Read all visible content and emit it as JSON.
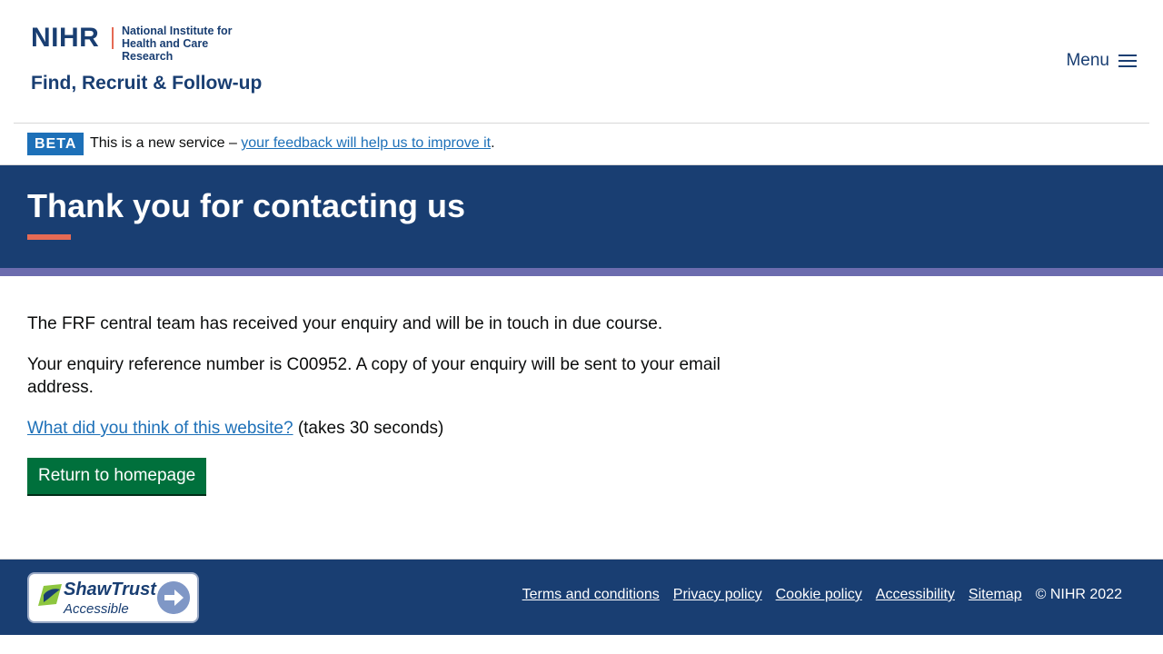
{
  "header": {
    "logo_org": "NIHR",
    "logo_inst_line1": "National Institute for",
    "logo_inst_line2": "Health and Care Research",
    "service_name": "Find, Recruit & Follow-up",
    "menu_label": "Menu",
    "menu_icon": "hamburger-icon"
  },
  "beta_banner": {
    "tag": "BETA",
    "text": "This is a new service – ",
    "link": "your feedback will help us to improve it",
    "suffix": "."
  },
  "hero": {
    "title": "Thank you for contacting us"
  },
  "main": {
    "para1": "The FRF central team has received your enquiry and will be in touch in due course.",
    "para2": "Your enquiry reference number is C00952. A copy of your enquiry will be sent to your email address.",
    "survey_link": "What did you think of this website?",
    "survey_suffix": " (takes 30 seconds)",
    "button": "Return to homepage"
  },
  "footer": {
    "badge_title": "ShawTrust",
    "badge_sub": "Accessible",
    "links": [
      "Terms and conditions",
      "Privacy policy",
      "Cookie policy",
      "Accessibility",
      "Sitemap"
    ],
    "copyright": "© NIHR 2022"
  },
  "colors": {
    "brand_navy": "#193e72",
    "accent_coral": "#e56a54",
    "stripe_purple": "#6c6cae",
    "link_blue": "#1d70b8",
    "button_green": "#00703c"
  }
}
